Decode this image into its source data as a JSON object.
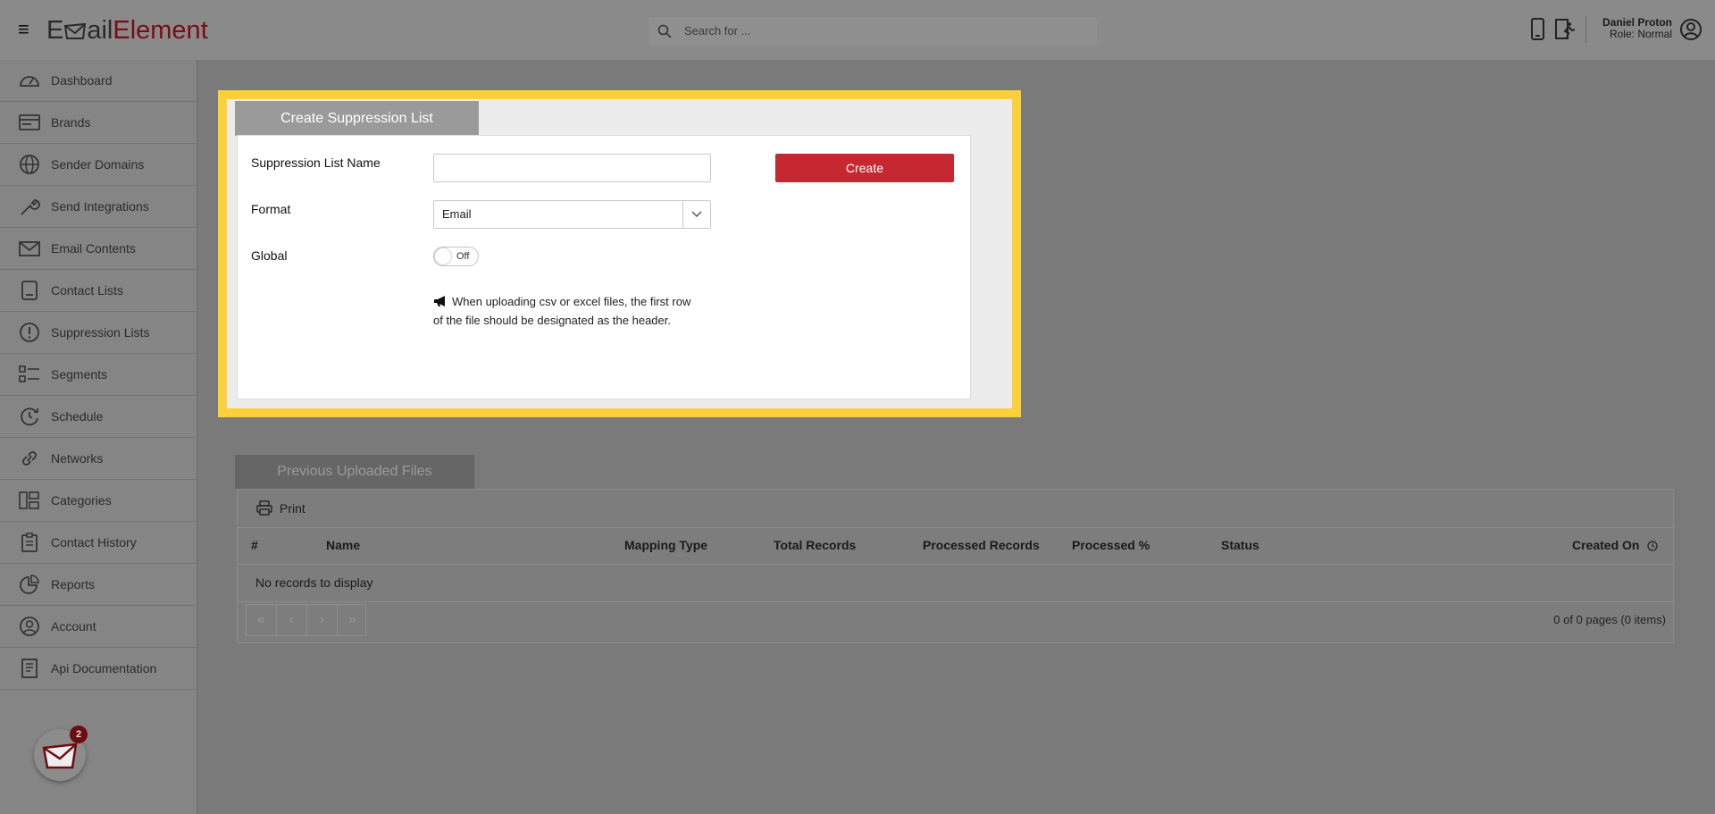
{
  "app": {
    "logo_part1": "E",
    "logo_part2": "ail",
    "logo_part3": "Element",
    "brand_color": "#7a0c14",
    "accent_color": "#c62832",
    "highlight_color": "#fdd03b"
  },
  "header": {
    "search_placeholder": "Search for ...",
    "user_name": "Daniel Proton",
    "user_role": "Role: Normal"
  },
  "sidebar": {
    "items": [
      {
        "label": "Dashboard",
        "icon": "dashboard-gauge-icon"
      },
      {
        "label": "Brands",
        "icon": "brands-card-icon"
      },
      {
        "label": "Sender Domains",
        "icon": "globe-icon"
      },
      {
        "label": "Send Integrations",
        "icon": "wrench-icon"
      },
      {
        "label": "Email Contents",
        "icon": "envelope-icon"
      },
      {
        "label": "Contact Lists",
        "icon": "contact-book-icon"
      },
      {
        "label": "Suppression Lists",
        "icon": "exclamation-circle-icon"
      },
      {
        "label": "Segments",
        "icon": "segments-list-icon"
      },
      {
        "label": "Schedule",
        "icon": "schedule-clock-icon"
      },
      {
        "label": "Networks",
        "icon": "link-icon"
      },
      {
        "label": "Categories",
        "icon": "categories-icon"
      },
      {
        "label": "Contact History",
        "icon": "clipboard-icon"
      },
      {
        "label": "Reports",
        "icon": "pie-chart-icon"
      },
      {
        "label": "Account",
        "icon": "user-circle-icon"
      },
      {
        "label": "Api Documentation",
        "icon": "document-icon"
      }
    ],
    "notification_count": "2"
  },
  "form": {
    "tab_title": "Create Suppression List",
    "name_label": "Suppression List Name",
    "name_value": "",
    "format_label": "Format",
    "format_value": "Email",
    "global_label": "Global",
    "global_toggle_text": "Off",
    "note_text": "When uploading csv or excel files, the first row of the file should be designated as the header.",
    "create_label": "Create"
  },
  "files": {
    "tab_title": "Previous Uploaded Files",
    "print_label": "Print",
    "columns": [
      "#",
      "Name",
      "Mapping Type",
      "Total Records",
      "Processed Records",
      "Processed %",
      "Status",
      "Created On"
    ],
    "empty_text": "No records to display",
    "pager": [
      "«",
      "‹",
      "›",
      "»"
    ],
    "page_info": "0 of 0 pages (0 items)"
  }
}
